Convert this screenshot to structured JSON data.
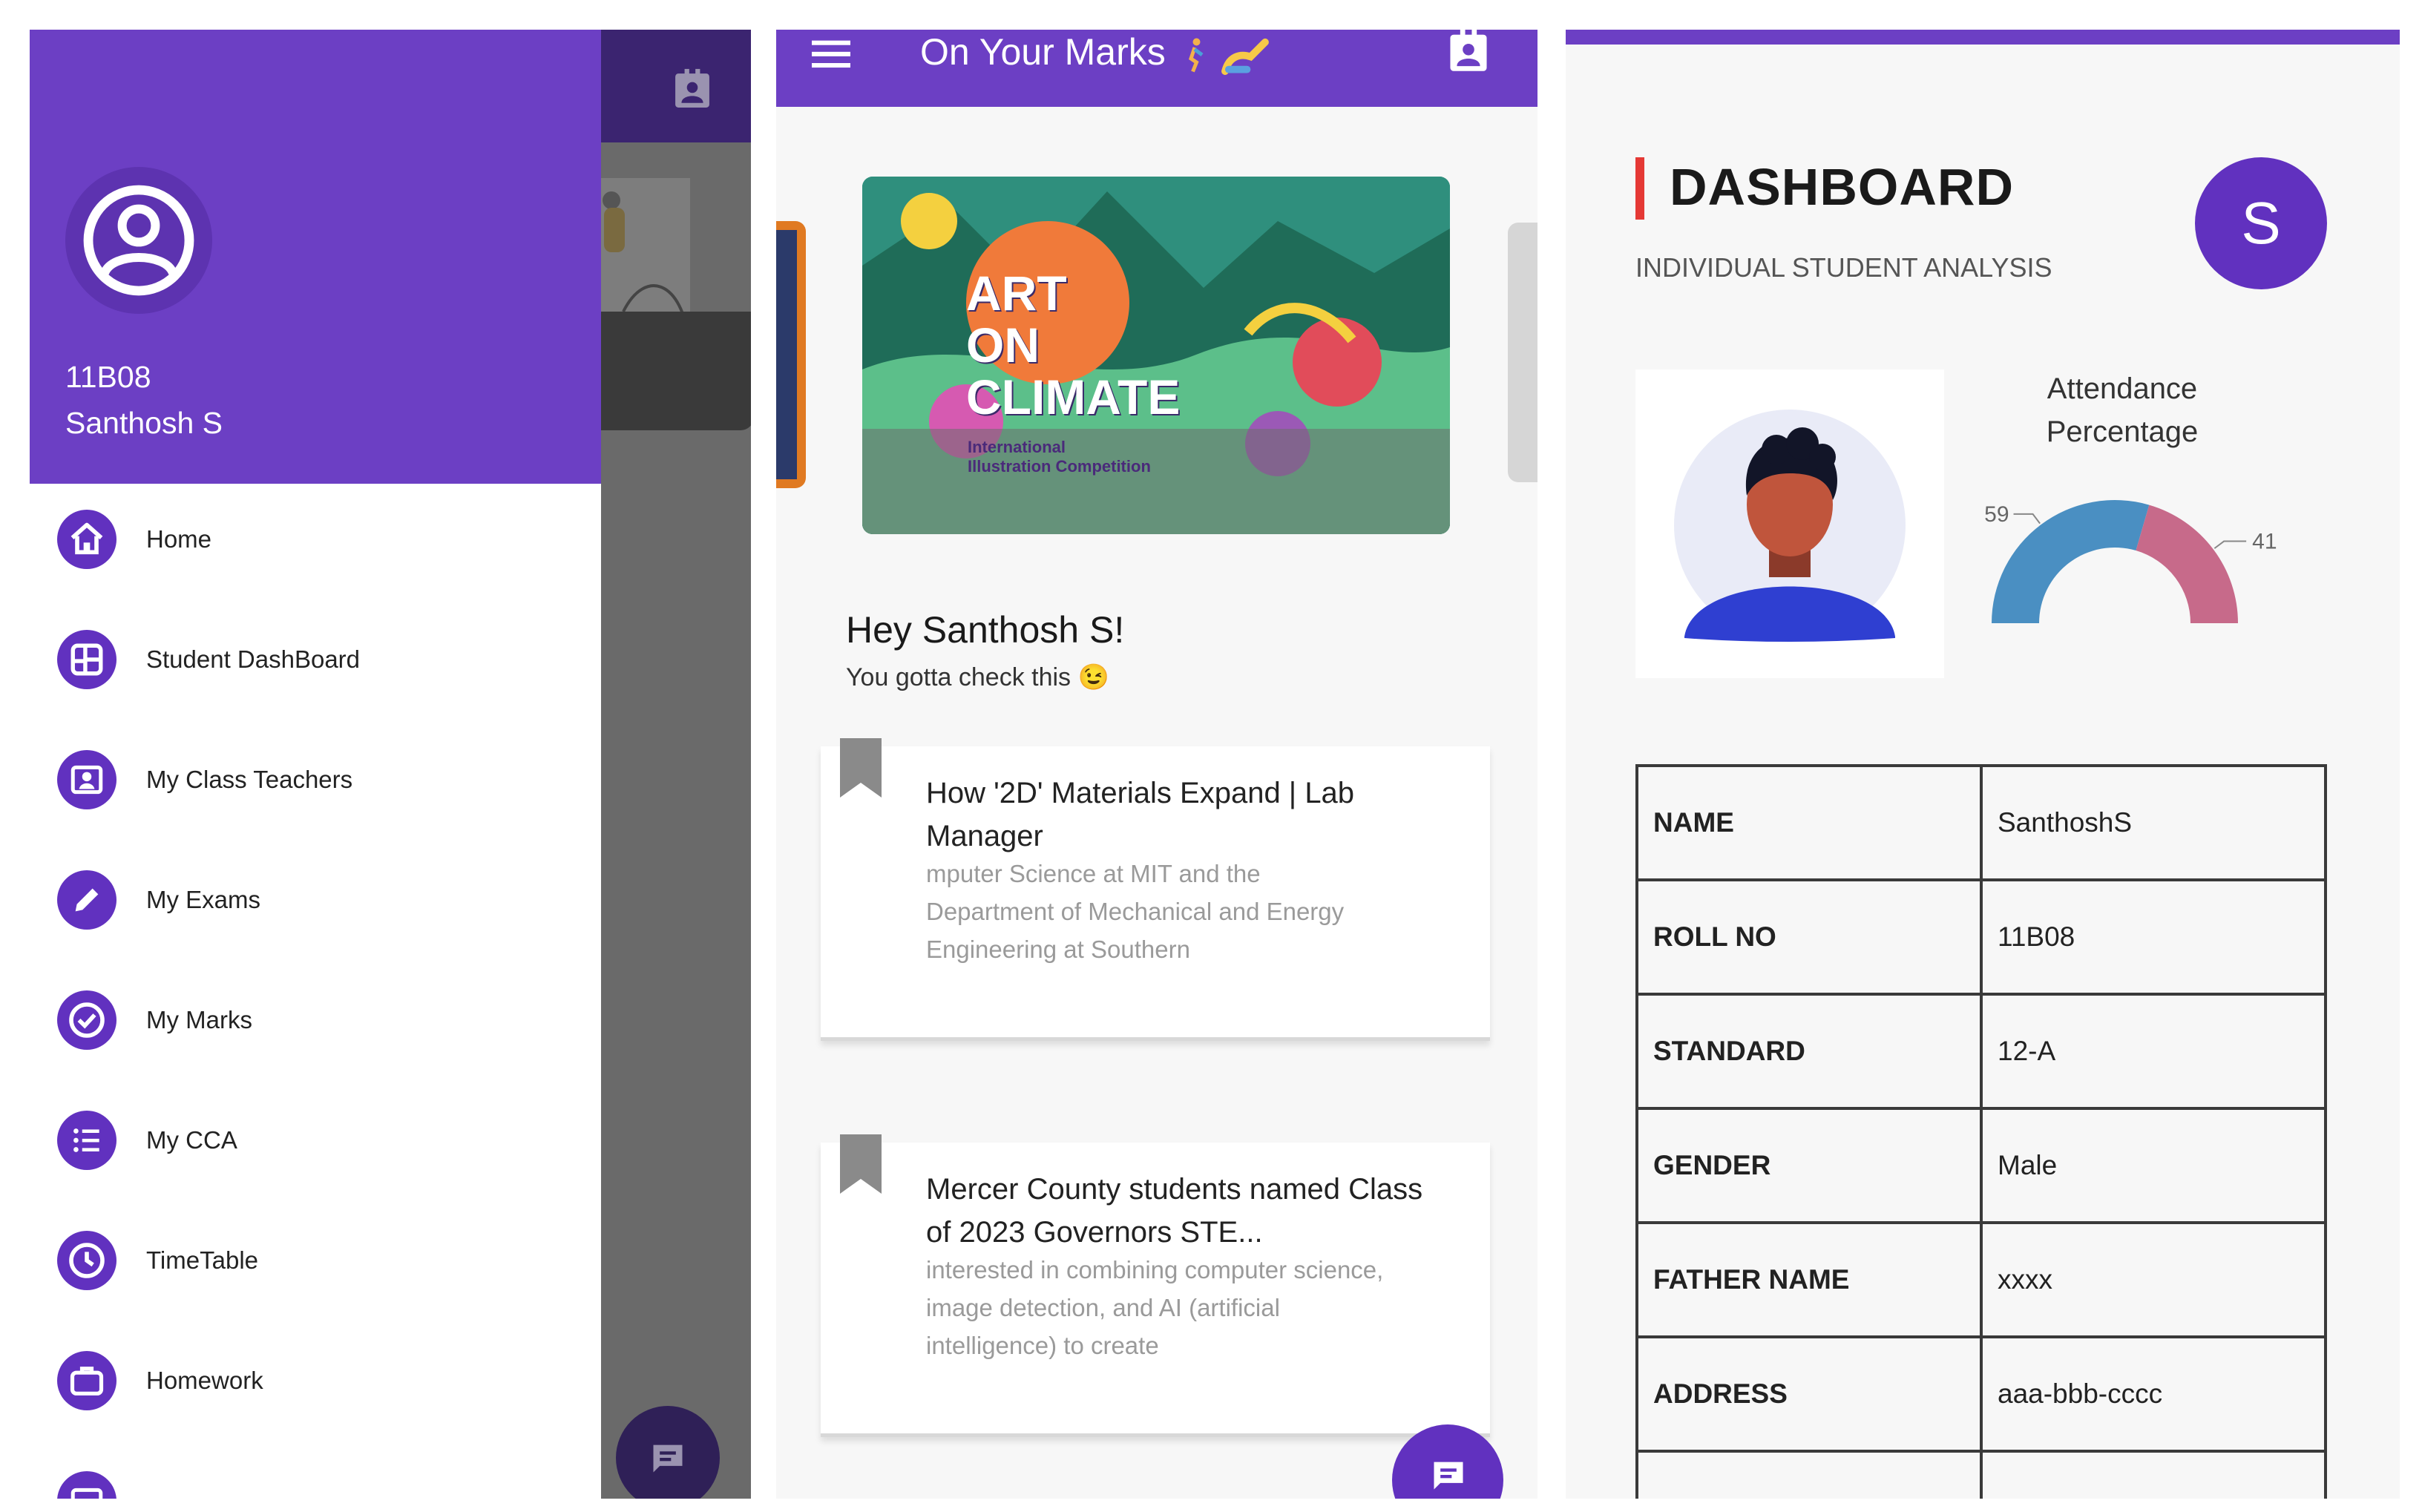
{
  "drawer": {
    "user_id": "11B08",
    "user_name": "Santhosh S",
    "items": [
      {
        "label": "Home",
        "icon": "home-icon"
      },
      {
        "label": "Student DashBoard",
        "icon": "dashboard-icon"
      },
      {
        "label": "My Class Teachers",
        "icon": "teacher-badge-icon"
      },
      {
        "label": "My Exams",
        "icon": "pencil-icon"
      },
      {
        "label": "My Marks",
        "icon": "check-circle-icon"
      },
      {
        "label": "My CCA",
        "icon": "list-icon"
      },
      {
        "label": "TimeTable",
        "icon": "clock-icon"
      },
      {
        "label": "Homework",
        "icon": "briefcase-icon"
      }
    ]
  },
  "home": {
    "app_title": "On Your Marks",
    "banner": {
      "line1": "ART",
      "line2": "ON",
      "line3": "CLIMATE",
      "caption1": "International",
      "caption2": "Illustration Competition"
    },
    "greeting": "Hey Santhosh S!",
    "subgreeting": "You gotta check this",
    "subgreeting_emoji": "😉",
    "news": [
      {
        "title": "How '2D' Materials Expand | Lab Manager",
        "snippet": "mputer Science at MIT and the Department of Mechanical and Energy Engineering at Southern"
      },
      {
        "title": "Mercer County students named Class of 2023 Governors STE...",
        "snippet": "interested in combining computer science, image detection, and AI (artificial intelligence) to create"
      }
    ]
  },
  "dashboard": {
    "title": "DASHBOARD",
    "subtitle": "INDIVIDUAL STUDENT ANALYSIS",
    "avatar_letter": "S",
    "attendance_label_1": "Attendance",
    "attendance_label_2": "Percentage",
    "table": [
      {
        "key": "NAME",
        "value": "SanthoshS"
      },
      {
        "key": "ROLL NO",
        "value": "11B08"
      },
      {
        "key": "STANDARD",
        "value": "12-A"
      },
      {
        "key": "GENDER",
        "value": "Male"
      },
      {
        "key": "FATHER NAME",
        "value": "xxxx"
      },
      {
        "key": "ADDRESS",
        "value": "aaa-bbb-cccc"
      }
    ]
  },
  "chart_data": {
    "type": "pie",
    "title": "Attendance Percentage",
    "categories": [
      "",
      ""
    ],
    "values": [
      59,
      41
    ],
    "colors": [
      "#4a8fc2",
      "#c76a8a"
    ]
  },
  "colors": {
    "primary": "#6c3fc4",
    "primary_dark": "#3b2470",
    "accent_red": "#e53935"
  }
}
